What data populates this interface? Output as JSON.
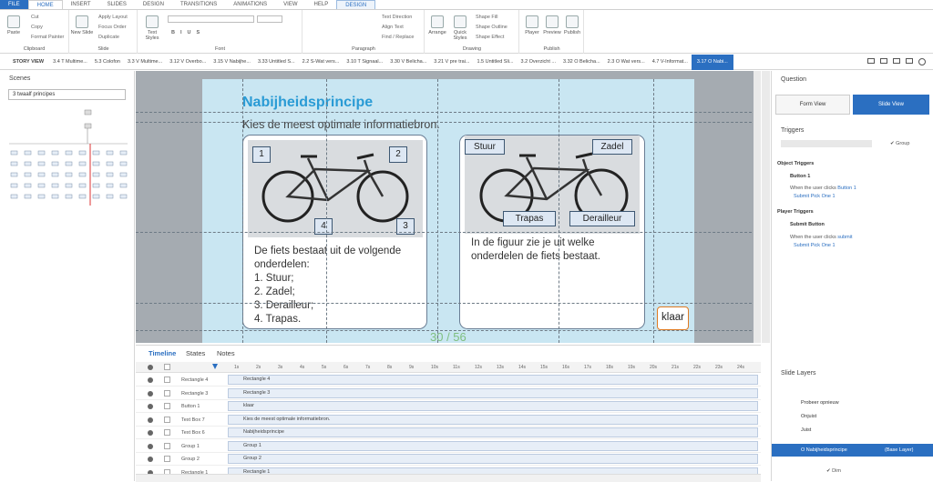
{
  "menu": {
    "tabs": [
      "FILE",
      "HOME",
      "INSERT",
      "SLIDES",
      "DESIGN",
      "TRANSITIONS",
      "ANIMATIONS",
      "VIEW",
      "HELP",
      "DESIGN"
    ]
  },
  "ribbon": {
    "clipboard": {
      "paste": "Paste",
      "cut": "Cut",
      "copy": "Copy",
      "format_painter": "Format Painter",
      "label": "Clipboard"
    },
    "slide": {
      "new_slide": "New Slide",
      "apply_layout": "Apply Layout",
      "focus_order": "Focus Order",
      "duplicate": "Duplicate",
      "label": "Slide"
    },
    "text_styles": "Text Styles",
    "font": {
      "label": "Font"
    },
    "paragraph": {
      "text_direction": "Text Direction",
      "align_text": "Align Text",
      "find_replace": "Find / Replace",
      "label": "Paragraph"
    },
    "drawing": {
      "arrange": "Arrange",
      "quick_styles": "Quick Styles",
      "shape_fill": "Shape Fill",
      "shape_outline": "Shape Outline",
      "shape_effect": "Shape Effect",
      "label": "Drawing"
    },
    "publish": {
      "player": "Player",
      "preview": "Preview",
      "publish": "Publish",
      "label": "Publish"
    }
  },
  "tabs": {
    "story_view": "STORY VIEW",
    "items": [
      "3.4 T Multime...",
      "5.3 Colofon",
      "3.3 V Multime...",
      "3.12 V Overbo...",
      "3.15 V Nabijhe...",
      "3.33 Untitled S...",
      "2.2 S-Wat vers...",
      "3.10 T Signaal...",
      "3.30 V Belicha...",
      "3.21 V pre trai...",
      "1.5 Untitled Sli...",
      "3.2 Overzicht ...",
      "3.32 O Belicha...",
      "2.3 O Wat vers...",
      "4.7 V-Informat..."
    ],
    "active": "3.17 O Nabi..."
  },
  "scenes": {
    "title": "Scenes",
    "selected": "3 twaalf principes"
  },
  "slide": {
    "title": "Nabijheidsprincipe",
    "subtitle": "Kies de meest optimale informatiebron.",
    "left_labels": [
      "1",
      "2",
      "4",
      "3"
    ],
    "left_text": {
      "intro": "De fiets bestaat uit de volgende onderdelen:",
      "items": [
        "1.  Stuur;",
        "2.  Zadel;",
        "3.  Derailleur;",
        "4.  Trapas."
      ]
    },
    "right_labels": [
      "Stuur",
      "Zadel",
      "Trapas",
      "Derailleur"
    ],
    "right_text": "In de figuur zie je uit welke onderdelen de fiets bestaat.",
    "button": "klaar",
    "page": "30 / 56"
  },
  "right": {
    "question": "Question",
    "form_view": "Form View",
    "slide_view": "Slide View",
    "triggers": "Triggers",
    "group": "Group",
    "object_triggers": "Object Triggers",
    "button1": "Button 1",
    "when_button": [
      "When the user clicks",
      "Button 1"
    ],
    "submit_pick": "Submit Pick One 1",
    "player_triggers": "Player Triggers",
    "submit_button": "Submit Button",
    "when_submit": [
      "When the user clicks",
      "submit"
    ],
    "submit_pick2": "Submit Pick One 1",
    "slide_layers": "Slide Layers",
    "layers": [
      "Probeer opnieuw",
      "Onjuist",
      "Juist"
    ],
    "base_layer": "O Nabijheidsprincipe",
    "base_tag": "(Base Layer)",
    "dim": "Dim"
  },
  "timeline": {
    "tabs": [
      "Timeline",
      "States",
      "Notes"
    ],
    "ticks": [
      "1s",
      "2s",
      "3s",
      "4s",
      "5s",
      "6s",
      "7s",
      "8s",
      "9s",
      "10s",
      "11s",
      "12s",
      "13s",
      "14s",
      "15s",
      "16s",
      "17s",
      "18s",
      "19s",
      "20s",
      "21s",
      "22s",
      "23s",
      "24s"
    ],
    "rows": [
      {
        "name": "Rectangle 4",
        "bar": "Rectangle 4"
      },
      {
        "name": "Rectangle 3",
        "bar": "Rectangle 3"
      },
      {
        "name": "Button 1",
        "bar": "klaar"
      },
      {
        "name": "Text Box 7",
        "bar": "Kies de meest optimale informatiebron."
      },
      {
        "name": "Text Box 6",
        "bar": "Nabijheidsprincipe"
      },
      {
        "name": "Group 1",
        "bar": "Group 1"
      },
      {
        "name": "Group 2",
        "bar": "Group 2"
      },
      {
        "name": "Rectangle 1",
        "bar": "Rectangle 1"
      }
    ]
  },
  "colors": {
    "accent": "#2b6fc1",
    "slide_bg": "#c9e6f2",
    "title": "#2a9bd5",
    "button_border": "#e07b22"
  }
}
